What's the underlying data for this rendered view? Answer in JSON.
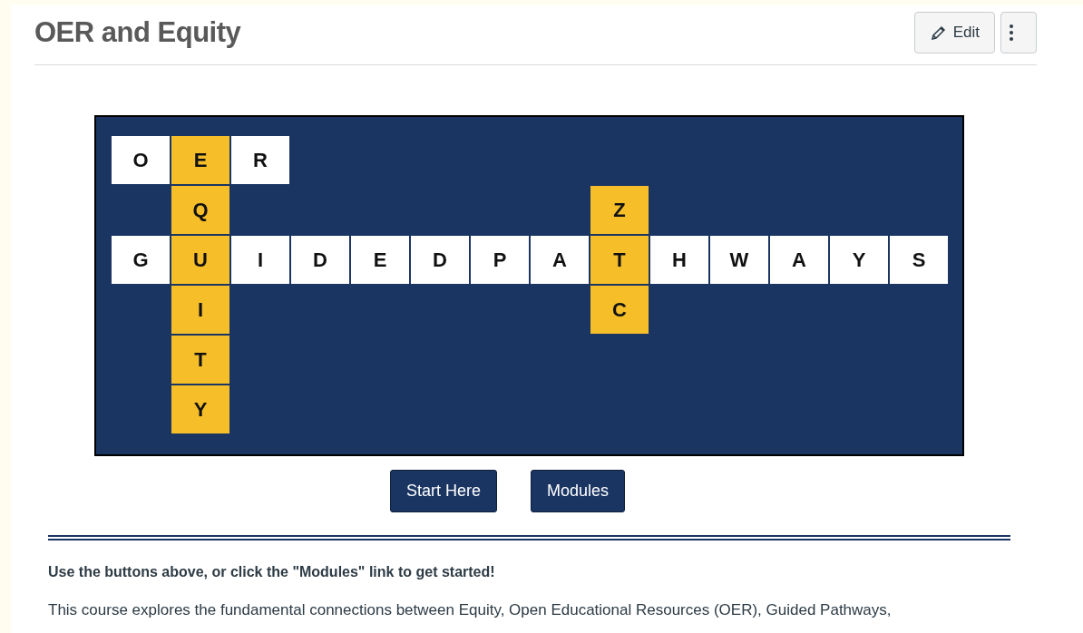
{
  "page_title": "OER and Equity",
  "header_buttons": [
    {
      "kind": "edit",
      "label": "Edit"
    },
    {
      "kind": "more"
    }
  ],
  "crossword": {
    "rows": [
      [
        {
          "kind": "white",
          "letter": "O"
        },
        {
          "kind": "gold",
          "letter": "E"
        },
        {
          "kind": "white",
          "letter": "R"
        }
      ],
      [
        {
          "kind": "blank"
        },
        {
          "kind": "gold",
          "letter": "Q"
        },
        {
          "kind": "blank"
        },
        {
          "kind": "blank"
        },
        {
          "kind": "blank"
        },
        {
          "kind": "blank"
        },
        {
          "kind": "blank"
        },
        {
          "kind": "blank"
        },
        {
          "kind": "gold",
          "letter": "Z"
        }
      ],
      [
        {
          "kind": "white",
          "letter": "G"
        },
        {
          "kind": "gold",
          "letter": "U"
        },
        {
          "kind": "white",
          "letter": "I"
        },
        {
          "kind": "white",
          "letter": "D"
        },
        {
          "kind": "white",
          "letter": "E"
        },
        {
          "kind": "white",
          "letter": "D"
        },
        {
          "kind": "white",
          "letter": "P"
        },
        {
          "kind": "white",
          "letter": "A"
        },
        {
          "kind": "gold",
          "letter": "T"
        },
        {
          "kind": "white",
          "letter": "H"
        },
        {
          "kind": "white",
          "letter": "W"
        },
        {
          "kind": "white",
          "letter": "A"
        },
        {
          "kind": "white",
          "letter": "Y"
        },
        {
          "kind": "white",
          "letter": "S"
        }
      ],
      [
        {
          "kind": "blank"
        },
        {
          "kind": "gold",
          "letter": "I"
        },
        {
          "kind": "blank"
        },
        {
          "kind": "blank"
        },
        {
          "kind": "blank"
        },
        {
          "kind": "blank"
        },
        {
          "kind": "blank"
        },
        {
          "kind": "blank"
        },
        {
          "kind": "gold",
          "letter": "C"
        }
      ],
      [
        {
          "kind": "blank"
        },
        {
          "kind": "gold",
          "letter": "T"
        }
      ],
      [
        {
          "kind": "blank"
        },
        {
          "kind": "gold",
          "letter": "Y"
        }
      ]
    ]
  },
  "nav_buttons": [
    "Start Here",
    "Modules"
  ],
  "intro": "Use the buttons above, or click the \"Modules\" link to get started!",
  "description": "This course explores the fundamental connections between Equity, Open Educational Resources (OER), Guided Pathways,"
}
